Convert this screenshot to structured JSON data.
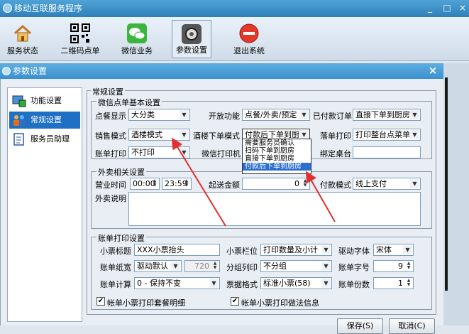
{
  "app": {
    "title": "移动互联服务程序",
    "minimize": "_",
    "maximize": "□",
    "close": "×"
  },
  "toolbar": [
    {
      "label": "服务状态",
      "icon": "house-icon"
    },
    {
      "label": "二维码点单",
      "icon": "qrcode-icon"
    },
    {
      "label": "微信业务",
      "icon": "wechat-icon"
    },
    {
      "label": "参数设置",
      "icon": "settings-icon",
      "active": true
    },
    {
      "label": "退出系统",
      "icon": "exit-icon"
    }
  ],
  "dialog": {
    "title": "参数设置",
    "close": "×"
  },
  "nav": [
    {
      "label": "功能设置",
      "icon": "function-settings-icon"
    },
    {
      "label": "常规设置",
      "icon": "users-icon",
      "selected": true
    },
    {
      "label": "服务员助理",
      "icon": "clipboard-icon"
    }
  ],
  "general": {
    "legend": "常规设置",
    "wechat": {
      "legend": "微信点单基本设置",
      "dish_display": {
        "label": "点餐显示",
        "value": "大分类"
      },
      "open_function": {
        "label": "开放功能",
        "value": "点餐/外卖/预定"
      },
      "paid_order": {
        "label": "已付款订单",
        "value": "直接下单到厨房"
      },
      "sales_mode": {
        "label": "销售模式",
        "value": "酒楼模式"
      },
      "restaurant_order_mode": {
        "label": "酒楼下单模式",
        "value": "付款后下单到厨房"
      },
      "order_print": {
        "label": "落单打印",
        "value": "打印整台点菜单"
      },
      "bill_print": {
        "label": "账单打印",
        "value": "不打印"
      },
      "wechat_printer": {
        "label": "微信打印机",
        "value": ""
      },
      "bind_table": {
        "label": "绑定桌台",
        "value": ""
      },
      "dropdown_options": [
        "需要服务员确认",
        "扫码下单到厨房",
        "直接下单到厨房",
        "付款后下单到厨房"
      ]
    },
    "takeout": {
      "legend": "外卖相关设置",
      "hours": {
        "label": "营业时间",
        "start": "00:00",
        "end": "23:59"
      },
      "delivery_min": {
        "label": "起送金额",
        "value": "0"
      },
      "payment_mode": {
        "label": "付款模式",
        "value": "线上支付"
      },
      "description": {
        "label": "外卖说明",
        "value": ""
      }
    },
    "bill": {
      "legend": "账单打印设置",
      "ticket_title": {
        "label": "小票标题",
        "value": "XXX小票抬头"
      },
      "ticket_column": {
        "label": "小票栏位",
        "value": "打印数量及小计"
      },
      "driver_font": {
        "label": "驱动字体",
        "value": "宋体"
      },
      "paper_width": {
        "label": "账单纸宽",
        "value": "驱动默认",
        "extra": "720"
      },
      "group_print": {
        "label": "分组列印",
        "value": "不分组"
      },
      "font_size": {
        "label": "账单字号",
        "value": "9"
      },
      "bill_calc": {
        "label": "账单计算",
        "value": "0 - 保持不变"
      },
      "ticket_format": {
        "label": "票据格式",
        "value": "标准小票(58)"
      },
      "copies": {
        "label": "账单份数",
        "value": "1"
      },
      "chk_set_detail": {
        "label": "帐单小票打印套餐明细",
        "checked": true
      },
      "chk_practice": {
        "label": "帐单小票打印做法信息",
        "checked": true
      }
    }
  },
  "buttons": {
    "save": "保存(S)",
    "cancel": "取消(C)"
  }
}
